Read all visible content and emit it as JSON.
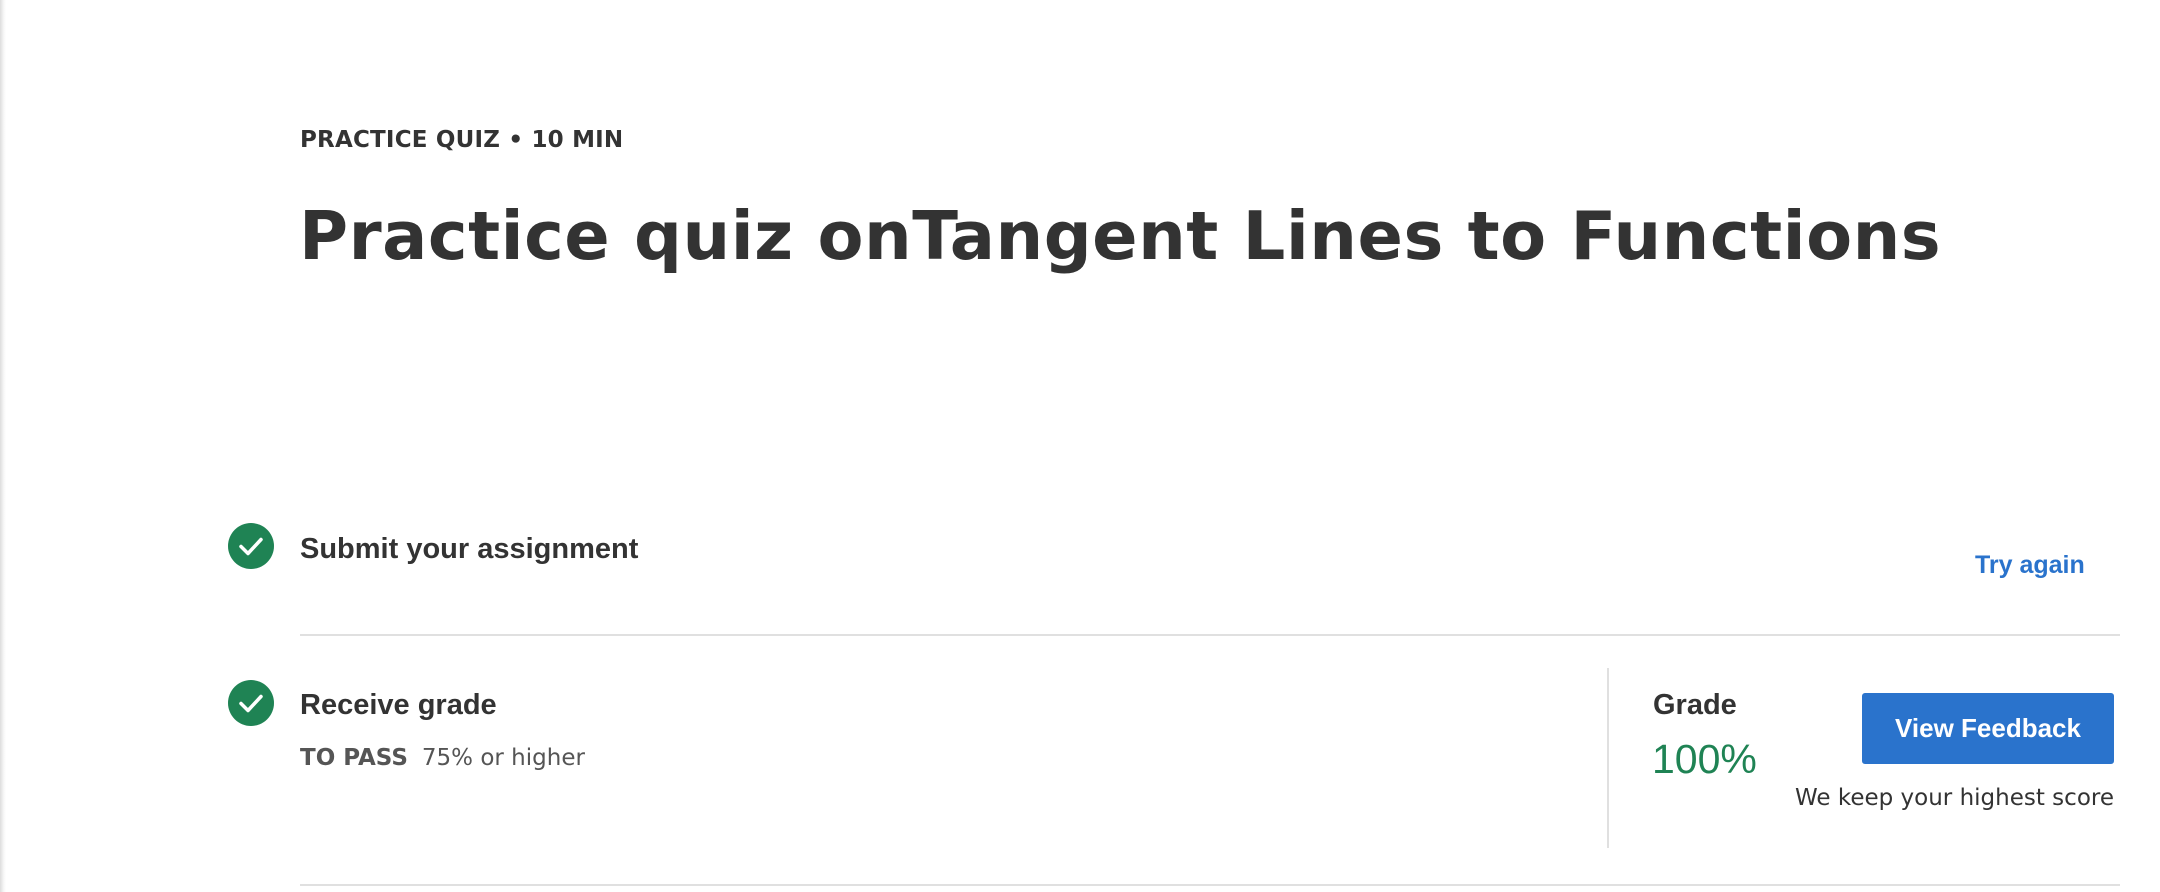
{
  "header": {
    "meta": "PRACTICE QUIZ • 10 MIN",
    "title": "Practice quiz onTangent Lines to Functions"
  },
  "steps": [
    {
      "label": "Submit your assignment",
      "status_icon": "check-circle-icon",
      "action_label": "Try again"
    },
    {
      "label": "Receive grade",
      "status_icon": "check-circle-icon",
      "pass_label": "TO PASS",
      "pass_value": "75% or higher"
    }
  ],
  "grade": {
    "label": "Grade",
    "value": "100%",
    "button_label": "View Feedback",
    "note": "We keep your highest score"
  },
  "colors": {
    "accent": "#2a73cc",
    "success": "#1f8354",
    "text": "#333333",
    "divider": "#e0e0e0"
  }
}
